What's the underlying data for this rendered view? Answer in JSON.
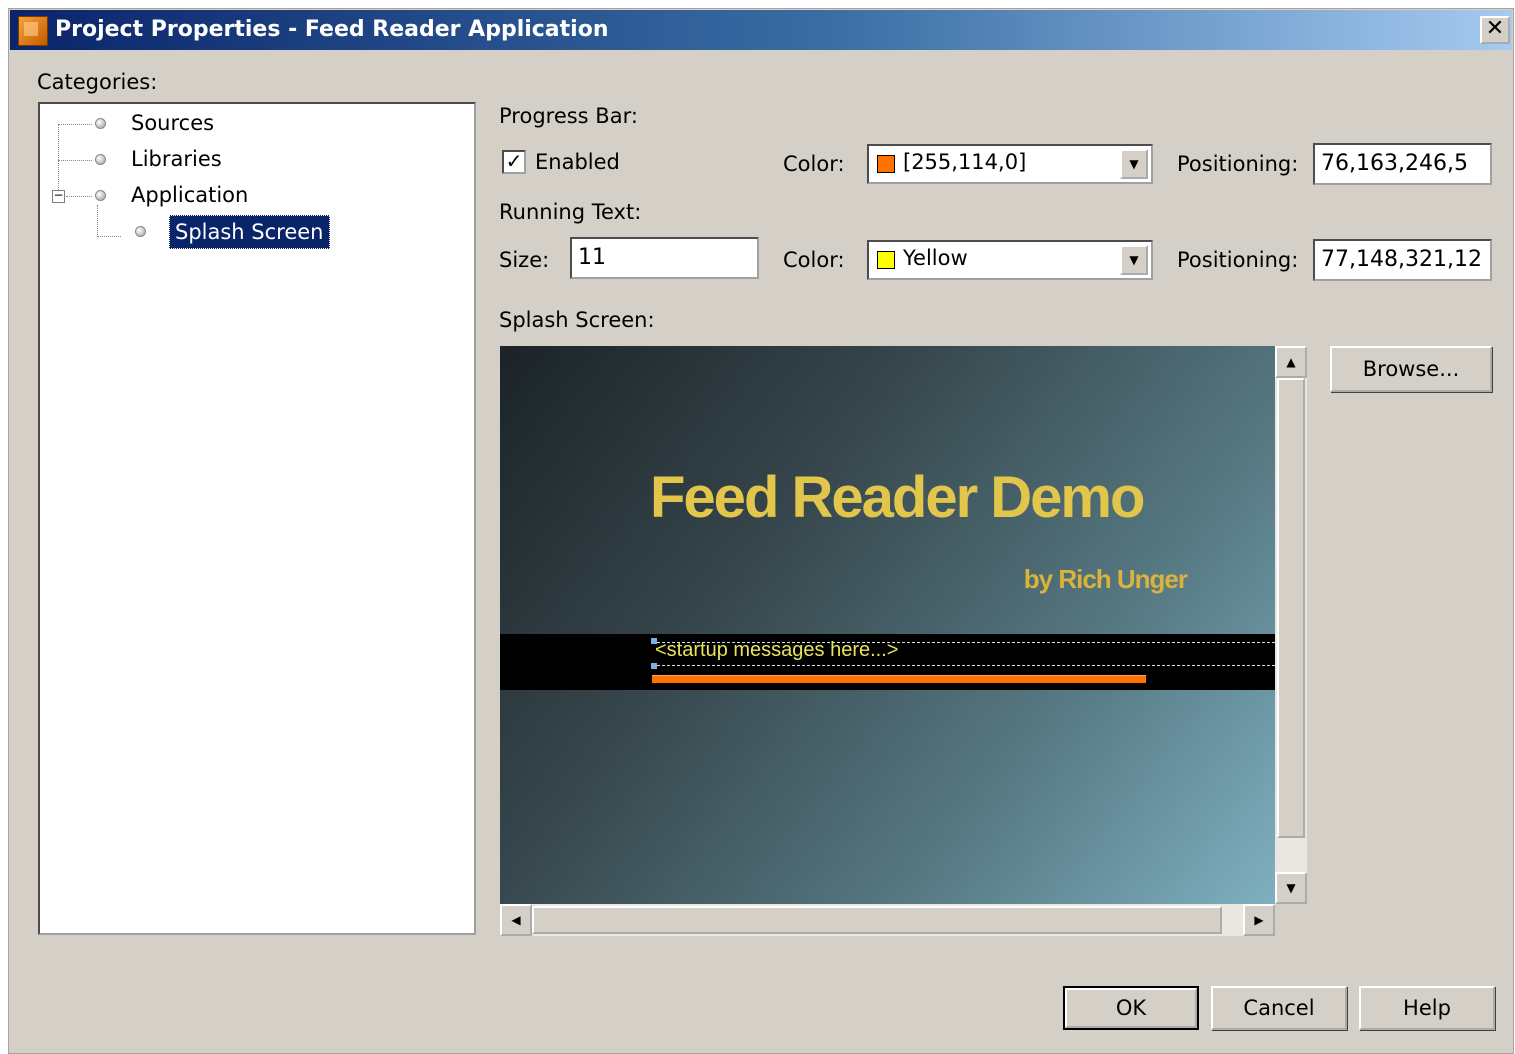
{
  "window": {
    "title": "Project Properties - Feed Reader Application",
    "close_glyph": "✕"
  },
  "categories": {
    "label": "Categories:",
    "items": [
      {
        "label": "Sources"
      },
      {
        "label": "Libraries"
      },
      {
        "label": "Application",
        "expanded": true
      },
      {
        "label": "Splash Screen",
        "selected": true
      }
    ]
  },
  "progress_bar": {
    "section_label": "Progress Bar:",
    "enabled_label": "Enabled",
    "enabled": true,
    "color_label": "Color:",
    "color_value": "[255,114,0]",
    "color_swatch": "#ff7200",
    "positioning_label": "Positioning:",
    "positioning_value": "76,163,246,5"
  },
  "running_text": {
    "section_label": "Running Text:",
    "size_label": "Size:",
    "size_value": "11",
    "color_label": "Color:",
    "color_value": "Yellow",
    "color_swatch": "#ffff00",
    "positioning_label": "Positioning:",
    "positioning_value": "77,148,321,12"
  },
  "splash_screen": {
    "section_label": "Splash Screen:",
    "browse_label": "Browse...",
    "preview": {
      "title": "Feed Reader Demo",
      "subtitle": "by Rich Unger",
      "message": "<startup messages here...>"
    }
  },
  "buttons": {
    "ok": "OK",
    "cancel": "Cancel",
    "help": "Help"
  },
  "colors": {
    "title_bar_start": "#0a246a",
    "title_bar_end": "#a6caf0",
    "dialog_bg": "#d4d0c8",
    "selection": "#0a246a",
    "splash_title": "#e2c64c",
    "progress": "#ff7200"
  }
}
